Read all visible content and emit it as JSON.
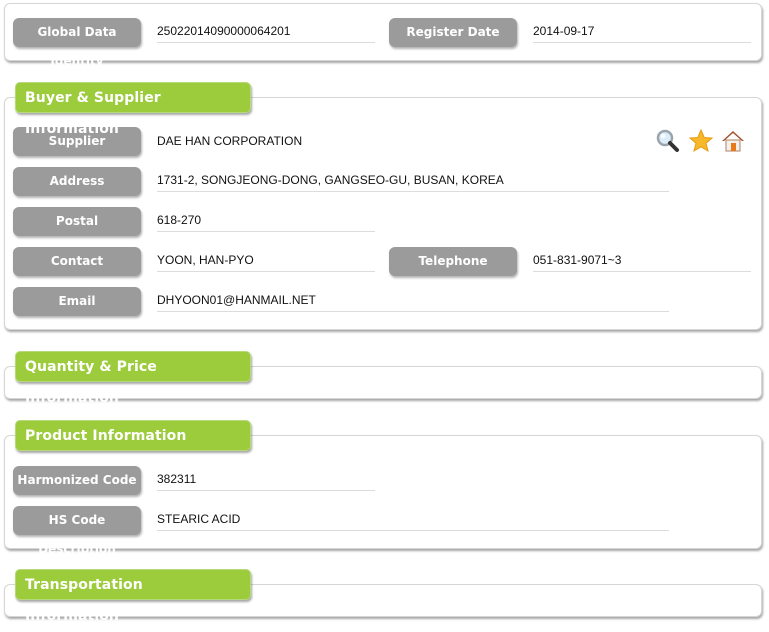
{
  "header": {
    "global_data_identity_label": "Global Data Identity",
    "global_data_identity_value": "25022014090000064201",
    "register_date_label": "Register Date",
    "register_date_value": "2014-09-17"
  },
  "buyer_supplier": {
    "title": "Buyer & Supplier Information",
    "supplier_label": "Supplier",
    "supplier_value": "DAE HAN CORPORATION",
    "address_label": "Address",
    "address_value": "1731-2, SONGJEONG-DONG, GANGSEO-GU, BUSAN, KOREA",
    "postal_label": "Postal",
    "postal_value": "618-270",
    "contact_label": "Contact",
    "contact_value": "YOON, HAN-PYO",
    "telephone_label": "Telephone",
    "telephone_value": "051-831-9071~3",
    "email_label": "Email",
    "email_value": "DHYOON01@HANMAIL.NET",
    "icons": [
      "search-icon",
      "star-icon",
      "home-icon"
    ]
  },
  "quantity_price": {
    "title": "Quantity & Price Information"
  },
  "product": {
    "title": "Product Information",
    "hs_code_label": "Harmonized Code",
    "hs_code_value": "382311",
    "hs_desc_label": "HS Code Description",
    "hs_desc_value": "STEARIC ACID"
  },
  "transportation": {
    "title": "Transportation Information"
  },
  "colors": {
    "section_title_bg": "#9ccb3b",
    "label_bg": "#9b9b9b"
  }
}
